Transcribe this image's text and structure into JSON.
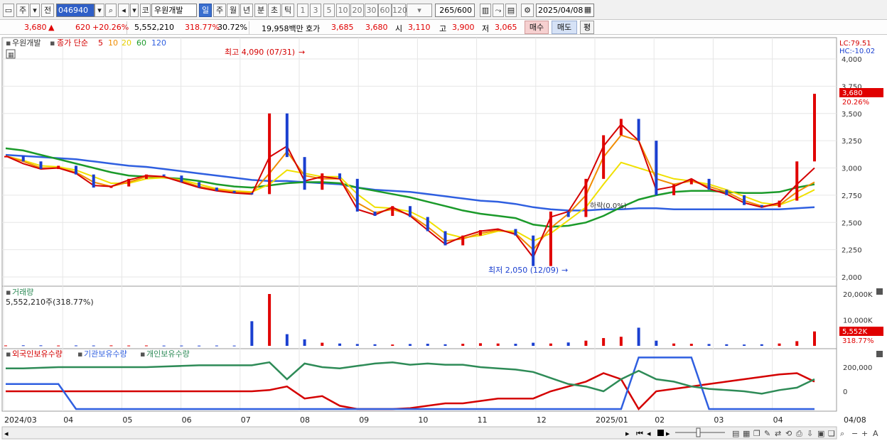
{
  "toolbar": {
    "type_label": "주",
    "prev_label": "전",
    "code": "046940",
    "market_label": "코",
    "name": "우원개발",
    "periods": [
      "일",
      "주",
      "월",
      "년",
      "분",
      "초",
      "틱"
    ],
    "selected_period": "일",
    "intervals": [
      "1",
      "3",
      "5",
      "10",
      "20",
      "30",
      "60",
      "120"
    ],
    "count": "265",
    "count_max": "/600",
    "date": "2025/04/08"
  },
  "quote": {
    "price": "3,680",
    "change": "620",
    "change_pct": "+20.26%",
    "volume": "5,552,210",
    "volume_ratio": "318.77%",
    "turnover": "30.72%",
    "amount": "19,958백만",
    "bid_label": "호가",
    "bid1": "3,685",
    "bid2": "3,680",
    "open_label": "시",
    "open": "3,110",
    "high_label": "고",
    "high": "3,900",
    "low_label": "저",
    "low": "3,065",
    "buy_label": "매수",
    "sell_label": "매도",
    "pyeong_label": "평"
  },
  "legend": {
    "stock_name": "우원개발",
    "ma_title": "종가 단순",
    "ma_periods": [
      "5",
      "10",
      "20",
      "60",
      "120"
    ],
    "volume_title": "거래량",
    "volume_value": "5,552,210주(318.77%)",
    "holdings": [
      "외국인보유수량",
      "기관보유수량",
      "개인보유수량"
    ]
  },
  "annotations": {
    "high": "최고 4,090 (07/31)",
    "low": "최저 2,050 (12/09)",
    "swing": "하락(0.0%)",
    "lc": "LC:79.51",
    "hc": "HC:-10.02",
    "price_badge": "3,680",
    "price_badge_pct": "20.26%",
    "vol_badge": "5,552K",
    "vol_badge_pct": "318.77%"
  },
  "colors": {
    "up": "#e00000",
    "down": "#1a3fd0",
    "ma5": "#d40000",
    "ma10": "#f08c00",
    "ma20": "#f0e000",
    "ma60": "#1b9a2a",
    "ma120": "#2f5fe0",
    "foreign": "#d40000",
    "institution": "#2f5fe0",
    "individual": "#2e8b57"
  },
  "chart_data": [
    {
      "type": "candlestick",
      "title": "우원개발",
      "ylim": [
        2000,
        4000
      ],
      "yticks": [
        "4,000",
        "3,750",
        "3,500",
        "3,250",
        "3,000",
        "2,750",
        "2,500",
        "2,250",
        "2,000"
      ],
      "x_labels": [
        "2024/03",
        "04",
        "05",
        "06",
        "07",
        "08",
        "09",
        "10",
        "11",
        "12",
        "2025/01",
        "02",
        "03",
        "04",
        "04/08"
      ],
      "close_path": [
        [
          "2024/03",
          3110
        ],
        [
          "2024/03",
          3060
        ],
        [
          "2024/03",
          2990
        ],
        [
          "2024/04",
          3020
        ],
        [
          "2024/04",
          2940
        ],
        [
          "2024/04",
          2820
        ],
        [
          "2024/05",
          2830
        ],
        [
          "2024/05",
          2900
        ],
        [
          "2024/05",
          2940
        ],
        [
          "2024/06",
          2930
        ],
        [
          "2024/06",
          2870
        ],
        [
          "2024/06",
          2820
        ],
        [
          "2024/07",
          2790
        ],
        [
          "2024/07",
          2770
        ],
        [
          "2024/07",
          2760
        ],
        [
          "2024/07/31",
          3500
        ],
        [
          "2024/08",
          3100
        ],
        [
          "2024/08",
          2800
        ],
        [
          "2024/08",
          2950
        ],
        [
          "2024/08",
          2900
        ],
        [
          "2024/09",
          2600
        ],
        [
          "2024/09",
          2560
        ],
        [
          "2024/09",
          2650
        ],
        [
          "2024/10",
          2550
        ],
        [
          "2024/10",
          2420
        ],
        [
          "2024/10",
          2290
        ],
        [
          "2024/11",
          2380
        ],
        [
          "2024/11",
          2430
        ],
        [
          "2024/11",
          2440
        ],
        [
          "2024/12",
          2380
        ],
        [
          "2024/12/09",
          2100
        ],
        [
          "2024/12",
          2600
        ],
        [
          "2024/12",
          2550
        ],
        [
          "2025/01",
          2900
        ],
        [
          "2025/01",
          3300
        ],
        [
          "2025/01",
          3450
        ],
        [
          "2025/02",
          3250
        ],
        [
          "2025/02",
          2750
        ],
        [
          "2025/02",
          2850
        ],
        [
          "2025/02",
          2900
        ],
        [
          "2025/03",
          2800
        ],
        [
          "2025/03",
          2750
        ],
        [
          "2025/03",
          2660
        ],
        [
          "2025/04",
          2640
        ],
        [
          "2025/04",
          2700
        ],
        [
          "2025/04",
          3060
        ],
        [
          "2025/04/08",
          3680
        ]
      ],
      "ma5": [
        3110,
        3040,
        2990,
        3000,
        2950,
        2840,
        2830,
        2890,
        2930,
        2920,
        2870,
        2820,
        2790,
        2770,
        2760,
        3100,
        3200,
        2880,
        2920,
        2900,
        2620,
        2570,
        2640,
        2560,
        2430,
        2300,
        2370,
        2420,
        2440,
        2390,
        2180,
        2550,
        2600,
        2850,
        3200,
        3400,
        3250,
        2800,
        2830,
        2900,
        2810,
        2760,
        2680,
        2640,
        2680,
        2850,
        3000
      ],
      "ma10": [
        3110,
        3060,
        3000,
        3000,
        2960,
        2870,
        2830,
        2870,
        2920,
        2920,
        2880,
        2830,
        2800,
        2780,
        2770,
        2950,
        3150,
        2930,
        2900,
        2900,
        2680,
        2590,
        2620,
        2570,
        2460,
        2330,
        2350,
        2400,
        2430,
        2400,
        2250,
        2450,
        2580,
        2750,
        3100,
        3300,
        3250,
        2900,
        2850,
        2880,
        2830,
        2780,
        2700,
        2650,
        2660,
        2780,
        2870
      ],
      "ma20": [
        3110,
        3070,
        3020,
        3010,
        2980,
        2920,
        2860,
        2860,
        2900,
        2910,
        2890,
        2850,
        2810,
        2790,
        2780,
        2850,
        2980,
        2950,
        2920,
        2920,
        2760,
        2640,
        2630,
        2600,
        2520,
        2400,
        2360,
        2380,
        2420,
        2420,
        2330,
        2400,
        2520,
        2640,
        2850,
        3050,
        3000,
        2950,
        2900,
        2880,
        2850,
        2800,
        2740,
        2680,
        2660,
        2720,
        2800
      ],
      "ma60": [
        3180,
        3160,
        3120,
        3080,
        3040,
        3000,
        2960,
        2930,
        2920,
        2910,
        2900,
        2880,
        2850,
        2830,
        2820,
        2840,
        2860,
        2870,
        2870,
        2860,
        2820,
        2790,
        2760,
        2730,
        2690,
        2650,
        2610,
        2580,
        2560,
        2540,
        2480,
        2460,
        2470,
        2500,
        2560,
        2640,
        2710,
        2750,
        2780,
        2790,
        2790,
        2780,
        2770,
        2770,
        2780,
        2820,
        2850
      ],
      "ma120": [
        3120,
        3110,
        3100,
        3090,
        3080,
        3060,
        3040,
        3020,
        3010,
        2990,
        2970,
        2950,
        2930,
        2910,
        2890,
        2880,
        2880,
        2870,
        2860,
        2850,
        2820,
        2800,
        2790,
        2780,
        2760,
        2740,
        2720,
        2700,
        2690,
        2670,
        2640,
        2620,
        2610,
        2610,
        2620,
        2620,
        2630,
        2630,
        2620,
        2620,
        2620,
        2620,
        2620,
        2620,
        2620,
        2630,
        2640
      ]
    },
    {
      "type": "bar",
      "title": "거래량",
      "yticks": [
        "20,000K",
        "10,000K"
      ],
      "ylim": [
        0,
        22000
      ],
      "values_k": [
        150,
        200,
        180,
        120,
        150,
        130,
        160,
        120,
        140,
        100,
        110,
        90,
        120,
        100,
        9500,
        20000,
        4500,
        2500,
        1200,
        900,
        700,
        600,
        500,
        700,
        800,
        600,
        800,
        1000,
        900,
        800,
        1200,
        900,
        1300,
        2000,
        3000,
        3500,
        7000,
        2000,
        900,
        800,
        700,
        600,
        500,
        600,
        900,
        1800,
        5552
      ]
    },
    {
      "type": "line",
      "title": "보유수량",
      "yticks": [
        "200,000",
        "0"
      ],
      "series": [
        {
          "name": "외국인보유수량",
          "values": [
            0,
            0,
            0,
            0,
            0,
            0,
            0,
            0,
            0,
            0,
            0,
            0,
            0,
            0,
            0,
            10000,
            40000,
            -60000,
            -40000,
            -120000,
            -160000,
            -160000,
            -160000,
            -140000,
            -120000,
            -100000,
            -100000,
            -80000,
            -60000,
            -60000,
            -60000,
            0,
            40000,
            80000,
            150000,
            100000,
            -150000,
            0,
            20000,
            40000,
            60000,
            80000,
            100000,
            120000,
            140000,
            150000,
            80000
          ]
        },
        {
          "name": "기관보유수량",
          "values": [
            60000,
            60000,
            60000,
            60000,
            -200000,
            -200000,
            -200000,
            -200000,
            -200000,
            -200000,
            -200000,
            -200000,
            -200000,
            -200000,
            -200000,
            -150000,
            -200000,
            -200000,
            -200000,
            -200000,
            -200000,
            -200000,
            -200000,
            -200000,
            -200000,
            -200000,
            -200000,
            -200000,
            -200000,
            -200000,
            -200000,
            -200000,
            -200000,
            -200000,
            -200000,
            -200000,
            280000,
            280000,
            280000,
            280000,
            -200000,
            -200000,
            -200000,
            -200000,
            -200000,
            -200000,
            -150000
          ]
        },
        {
          "name": "개인보유수량",
          "values": [
            190000,
            190000,
            195000,
            200000,
            200000,
            200000,
            200000,
            200000,
            200000,
            205000,
            210000,
            215000,
            215000,
            215000,
            215000,
            240000,
            100000,
            230000,
            200000,
            190000,
            210000,
            230000,
            240000,
            220000,
            230000,
            220000,
            220000,
            200000,
            190000,
            180000,
            160000,
            110000,
            60000,
            40000,
            0,
            100000,
            170000,
            100000,
            80000,
            40000,
            20000,
            10000,
            0,
            -20000,
            10000,
            30000,
            100000
          ]
        }
      ]
    }
  ]
}
